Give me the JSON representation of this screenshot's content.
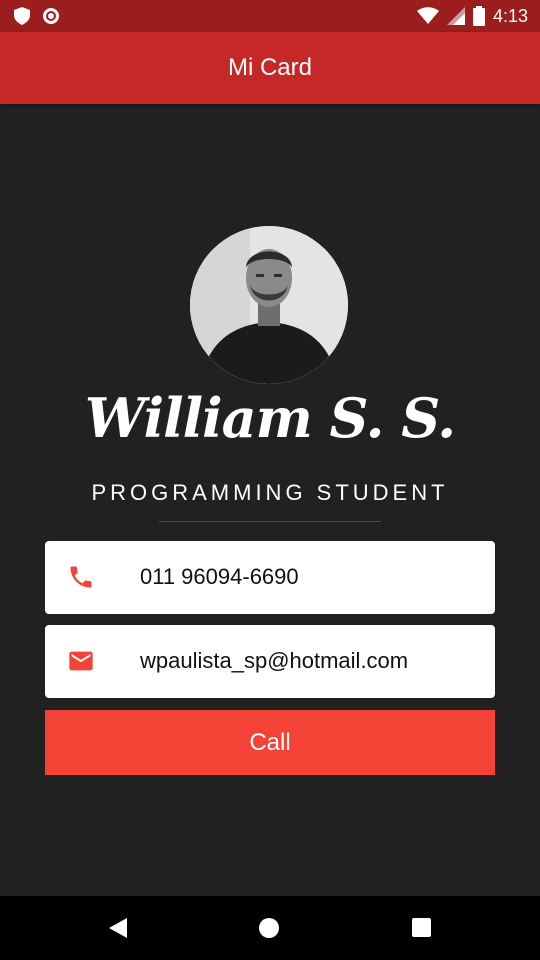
{
  "status_bar": {
    "time": "4:13",
    "left_icons": [
      "shield-icon",
      "record-icon"
    ],
    "right_icons": [
      "wifi-icon",
      "signal-icon",
      "battery-icon"
    ]
  },
  "app_bar": {
    "title": "Mi Card"
  },
  "profile": {
    "name": "William S. S.",
    "role": "PROGRAMMING STUDENT"
  },
  "cards": {
    "phone": {
      "icon": "phone-icon",
      "text": "011 96094-6690"
    },
    "email": {
      "icon": "mail-icon",
      "text": "wpaulista_sp@hotmail.com"
    }
  },
  "actions": {
    "call_label": "Call"
  },
  "nav": {
    "buttons": [
      "back-icon",
      "home-icon",
      "recents-icon"
    ]
  },
  "colors": {
    "primary": "#c62828",
    "status_bar": "#9c1d1d",
    "accent": "#f44336",
    "background": "#212121",
    "card": "#ffffff"
  }
}
